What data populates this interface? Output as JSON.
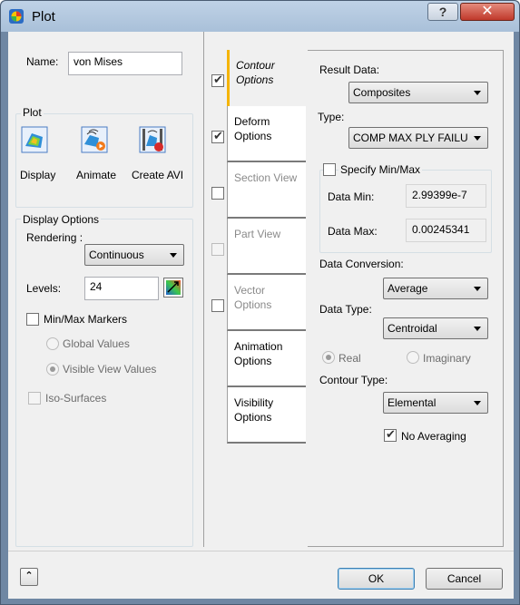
{
  "window": {
    "title": "Plot",
    "help_label": "?",
    "close_label": "✕"
  },
  "left": {
    "name_label": "Name:",
    "name_value": "von Mises",
    "plot_group": "Plot",
    "tools": [
      {
        "label": "Display",
        "icon": "display-icon"
      },
      {
        "label": "Animate",
        "icon": "animate-icon"
      },
      {
        "label": "Create AVI",
        "icon": "create-avi-icon"
      }
    ],
    "display_options": {
      "title": "Display Options",
      "rendering_label": "Rendering :",
      "rendering_value": "Continuous",
      "levels_label": "Levels:",
      "levels_value": "24",
      "minmax_label": "Min/Max Markers",
      "global_values_label": "Global Values",
      "visible_view_values_label": "Visible View Values",
      "iso_surfaces_label": "Iso-Surfaces"
    }
  },
  "tabs": [
    {
      "line1": "Contour",
      "line2": "Options",
      "checked": true
    },
    {
      "line1": "Deform",
      "line2": "Options",
      "checked": true
    },
    {
      "line1": "Section View",
      "line2": "",
      "checked": false
    },
    {
      "line1": "Part View",
      "line2": "",
      "checked": false
    },
    {
      "line1": "Vector",
      "line2": "Options",
      "checked": false
    },
    {
      "line1": "Animation",
      "line2": "Options",
      "checked": null
    },
    {
      "line1": "Visibility",
      "line2": "Options",
      "checked": null
    }
  ],
  "contour": {
    "result_data_label": "Result Data:",
    "result_data_value": "Composites",
    "type_label": "Type:",
    "type_value": "COMP MAX PLY FAILU",
    "specify_minmax_label": "Specify Min/Max",
    "data_min_label": "Data Min:",
    "data_min_value": "2.99399e-7",
    "data_max_label": "Data Max:",
    "data_max_value": "0.00245341",
    "data_conversion_label": "Data Conversion:",
    "data_conversion_value": "Average",
    "data_type_label": "Data Type:",
    "data_type_value": "Centroidal",
    "real_label": "Real",
    "imaginary_label": "Imaginary",
    "contour_type_label": "Contour Type:",
    "contour_type_value": "Elemental",
    "no_averaging_label": "No Averaging"
  },
  "footer": {
    "expand_label": "⌃",
    "ok_label": "OK",
    "cancel_label": "Cancel"
  }
}
